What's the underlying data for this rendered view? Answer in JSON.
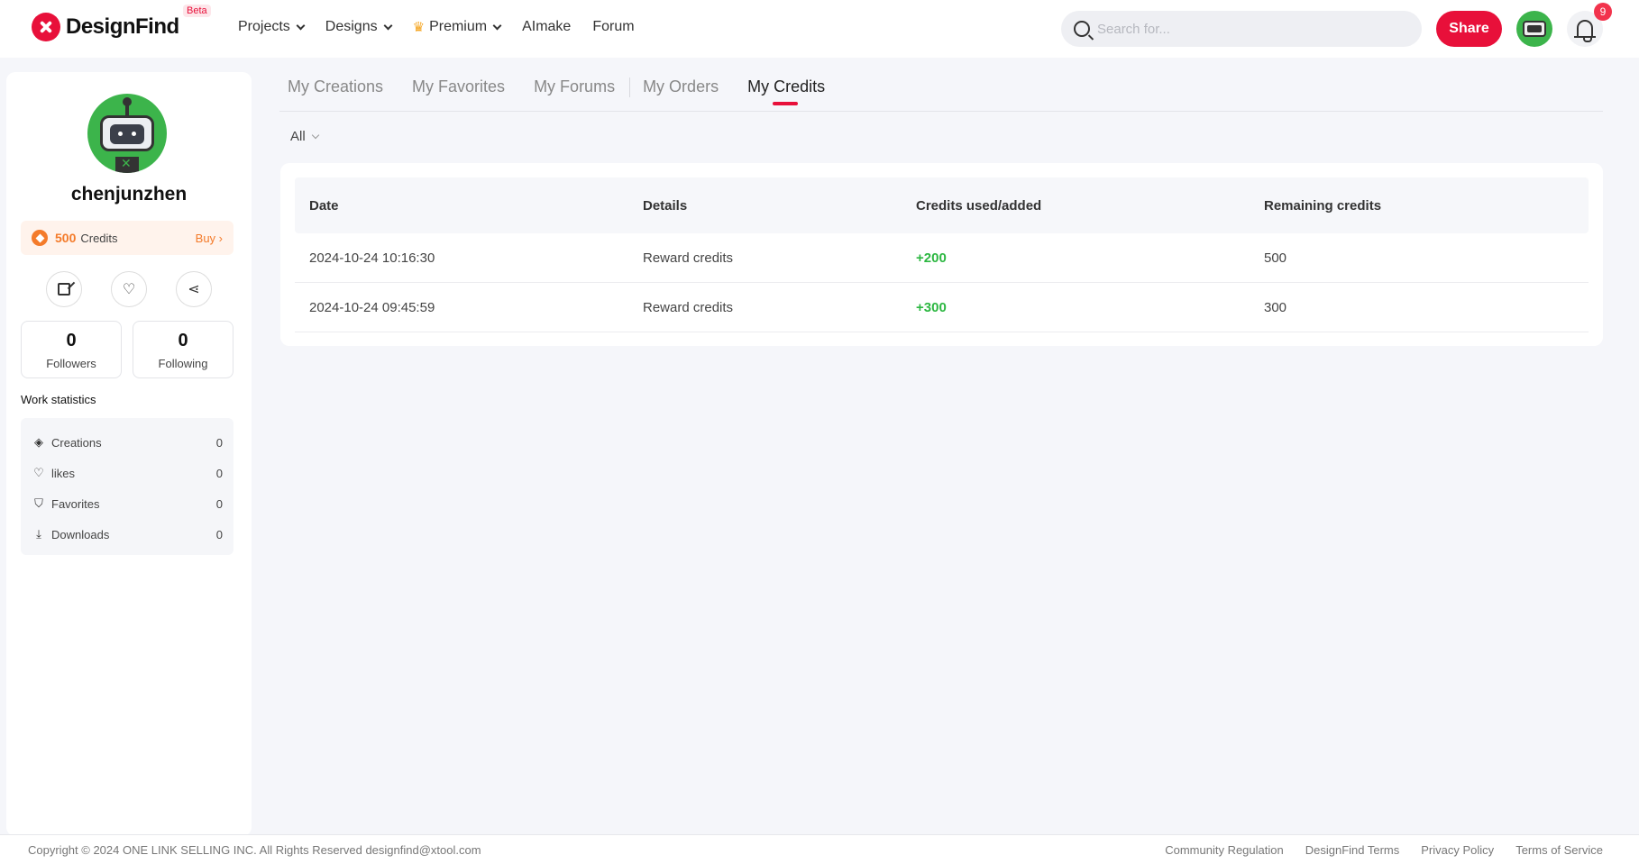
{
  "header": {
    "logo_text": "DesignFind",
    "beta_label": "Beta",
    "nav": [
      {
        "label": "Projects"
      },
      {
        "label": "Designs"
      },
      {
        "label": "Premium"
      },
      {
        "label": "AImake"
      },
      {
        "label": "Forum"
      }
    ],
    "search_placeholder": "Search for...",
    "share_label": "Share",
    "notification_count": "9"
  },
  "profile": {
    "username": "chenjunzhen",
    "credits_value": "500",
    "credits_label": "Credits",
    "buy_label": "Buy ›",
    "followers": {
      "value": "0",
      "label": "Followers"
    },
    "following": {
      "value": "0",
      "label": "Following"
    },
    "stats_title": "Work statistics",
    "stats": [
      {
        "icon": "layers-icon",
        "label": "Creations",
        "value": "0"
      },
      {
        "icon": "heart-icon",
        "label": "likes",
        "value": "0"
      },
      {
        "icon": "bookmark-icon",
        "label": "Favorites",
        "value": "0"
      },
      {
        "icon": "download-icon",
        "label": "Downloads",
        "value": "0"
      }
    ]
  },
  "tabs": [
    {
      "label": "My Creations"
    },
    {
      "label": "My Favorites"
    },
    {
      "label": "My Forums"
    },
    {
      "label": "My Orders"
    },
    {
      "label": "My Credits",
      "active": true
    }
  ],
  "filter": {
    "selected": "All"
  },
  "table": {
    "columns": [
      "Date",
      "Details",
      "Credits used/added",
      "Remaining credits"
    ],
    "rows": [
      {
        "date": "2024-10-24 10:16:30",
        "details": "Reward credits",
        "change": "+200",
        "remaining": "500"
      },
      {
        "date": "2024-10-24 09:45:59",
        "details": "Reward credits",
        "change": "+300",
        "remaining": "300"
      }
    ]
  },
  "footer": {
    "copyright": "Copyright © 2024 ONE LINK SELLING INC. All Rights Reserved designfind@xtool.com",
    "links": [
      "Community Regulation",
      "DesignFind Terms",
      "Privacy Policy",
      "Terms of Service"
    ]
  },
  "colors": {
    "accent": "#e8103a",
    "credit_orange": "#f47b2a",
    "positive_green": "#2db742",
    "avatar_green": "#3cb44b"
  }
}
